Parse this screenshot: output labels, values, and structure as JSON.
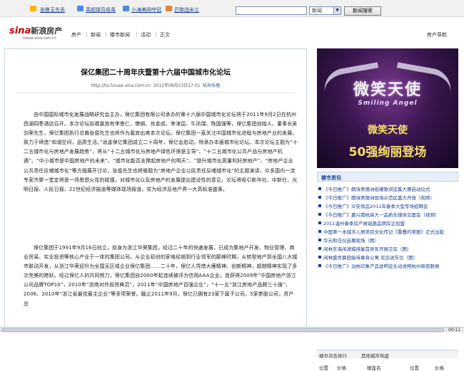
{
  "topbar": {
    "links": [
      "张曼玉先丢",
      "英超球员吸毒",
      "小涛美网夺冠",
      "巴黎战米兰"
    ],
    "search_button": "新闻搜索",
    "search_select": "新闻"
  },
  "nav": {
    "logo_text": "sina",
    "logo_sub": "新浪房产",
    "logo_url": "house.sina.com.cn",
    "breadcrumb": [
      "房产",
      "新闻",
      "楼市新闻",
      "活动",
      "正文"
    ],
    "right_link": "房产导航"
  },
  "article": {
    "title": "保亿集团二十周年庆暨第十六届中国城市化论坛",
    "meta_url": "http://hz.house.sina.com.cn",
    "meta_date": "2011年08月23日17:01",
    "meta_source": "杭州乐居",
    "paragraph1": "由中国国际城市化发展战略研究会主办，保亿集团有限公司承办的第十六届中国城市化论坛将于2011年9月2日在杭州西湖四季酒店召开。本次论坛拟邀嘉宾有李景仁、樊纲、肖金成、李津逵、牛凤瑞、陈国强等，保亿集团创始人、董事长吴剑荣先生，保亿集团执行总裁张俊先生也将作为嘉宾出席本次论坛。保亿集团一直关注中国城市化进程与房地产业的发展，致力于缔造“和谐空间，品质生活。”适逢保亿集团成立二十周年，保亿会启动，特承办本届城市化论坛。本次论坛主题为“十二五城市化与房地产发展趋势”，将从“十二五城市化与房地产绿色环保是主导”、“十二五城市化公共产品与房地产机遇”、“中小城市是中国房地产的未来”、“城市化能否支撑起房地产的明天”、“提升城市化质量利好房地产”、“房地产企业公共责任反哺城市化”等方面展开讨论，张俊先生也将做题为“房地产企业公民责任反哺城市化”的主题演讲，众多国内一流专家齐聚一堂定将是一场思想火花的碰撞，对城市化以及房地产的发展提出建设性的意见，论坛将吸引新华社、中新社、光明日报、人民日报、21世纪经济报道等媒体现场报道，实为经济及地产界一大高标准盛事。",
    "paragraph2": "保亿集团于1991年9月16日创立，前身为浙江华荣集团，经过二十年的快速发展，已成为集地产开发、物业管理、商业贸易、实业投资等核心产业于一体的集团公司。从企业初创的家电经销到行业领军的巅峰时期，从转型地产到全国八大城市联动开发，从浙江华荣迎升为全国无区域企业保亿集团……二十年，保亿人凭借大雁精神、创新精神，超越精神实现了多次完美的跨跃。经过保亿人的共同努力，保亿集团自2000年起连续被评为信用AAA企业，连获得2009年“中国房地产浙江公司品牌TOP10”，2010年“浙商对外投资典范”，2011年“中国房地产百强企业”，“十一五”浙江房地产品牌三十强”，2006、2010年“浙江省最佳雇主企业”等多项荣誉。截止2011年9月，保亿已拥有23家下属子公司，5家参股公司，资产总"
  },
  "ad": {
    "title": "微笑天使",
    "subtitle": "Smiling Angel",
    "line1": "微笑天使",
    "line2": "50强绚丽登场"
  },
  "news": {
    "header": "楼市资讯",
    "items": [
      "《今日推广》朗诗美丽洲纸硬歌词征集大赛启动仪式",
      "《今日推广》朗诗美丽洲现场示范区盛大开放（视频）",
      "《今日推广》众安尚品2011年春季大型专场招聘会",
      "《今日推广》嘉兴南杭高大一品新年媒体见面会（视频）",
      "2011温州春季房产展诚邀品牌房企加盟",
      "中国第一本城市人居项目文化传记《重叠的美丽》正式出版",
      "华元和庄仪启幕现场（图）",
      "闲林东海闲湖城排屋首席年开展交房（图）",
      "闲林盛世慕园接待果身公寓 买房送车位（图）",
      "《今日推广》泊杭印象产品说明会生动说明杭州新民联展"
    ]
  },
  "rank": {
    "header": "楼市点击排行",
    "tab2": "其他城市热盘",
    "cols": [
      "位置",
      "价格",
      "楼盘名",
      "位置",
      "价格"
    ]
  },
  "status": {
    "time": "00:11"
  }
}
